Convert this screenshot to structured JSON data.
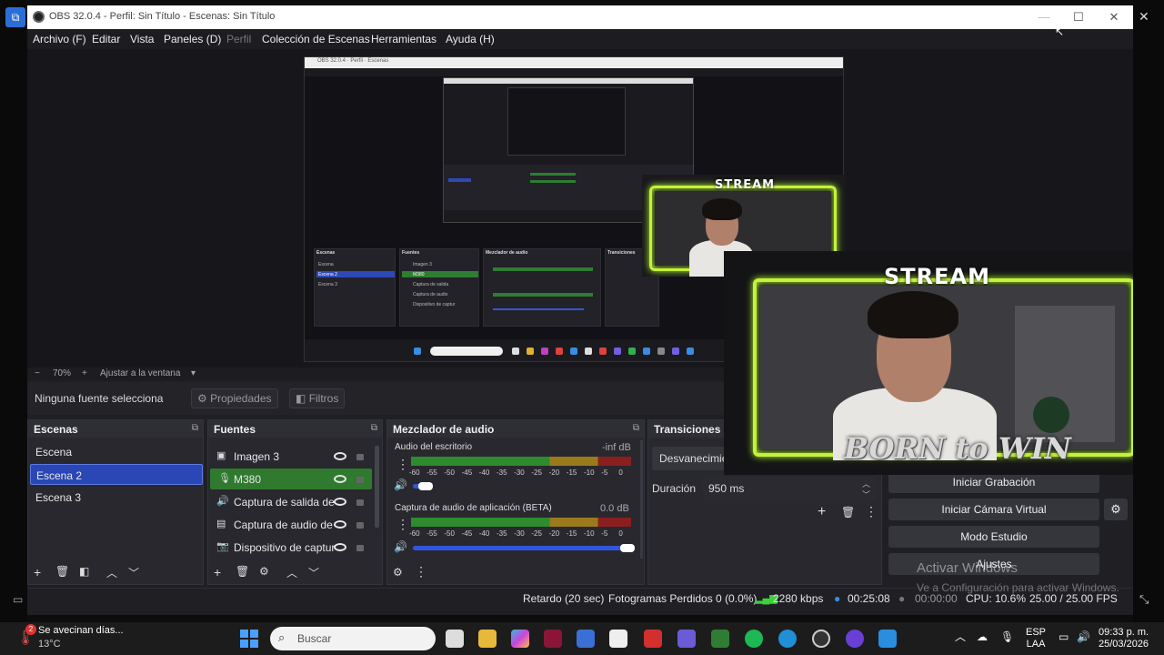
{
  "window": {
    "title": "OBS 32.0.4 - Perfil: Sin Título - Escenas: Sin Título",
    "minimize_icon": "minimize-icon",
    "maximize_icon": "maximize-icon",
    "close_icon": "close-icon"
  },
  "menu": [
    "Archivo (F)",
    "Editar",
    "Vista",
    "Paneles (D)",
    "Perfil",
    "Colección de Escenas",
    "Herramientas",
    "Ayuda (H)"
  ],
  "overlay": {
    "stream_text": "STREAM",
    "born_text": "BORN to WIN"
  },
  "zoom": {
    "minus": "−",
    "value": "70%",
    "plus": "+",
    "fit": "Ajustar a la ventana"
  },
  "source_bar": {
    "no_selection": "Ninguna fuente selecciona",
    "properties": "Propiedades",
    "filters": "Filtros"
  },
  "scenes": {
    "title": "Escenas",
    "items": [
      "Escena",
      "Escena 2",
      "Escena 3"
    ],
    "selected": "Escena 2"
  },
  "sources": {
    "title": "Fuentes",
    "items": [
      {
        "label": "Imagen 3",
        "icon": "image-icon"
      },
      {
        "label": "M380",
        "icon": "microphone-icon"
      },
      {
        "label": "Captura de salida de",
        "icon": "speaker-icon"
      },
      {
        "label": "Captura de audio de",
        "icon": "window-capture-icon"
      },
      {
        "label": "Dispositivo de captur",
        "icon": "camera-icon"
      }
    ]
  },
  "mixer": {
    "title": "Mezclador de audio",
    "tracks": [
      {
        "name": "Audio del escritorio",
        "level": "-inf dB",
        "volume": 0.06
      },
      {
        "name": "Captura de audio de aplicación (BETA)",
        "level": "0.0 dB",
        "volume": 1.0
      }
    ],
    "ticks": [
      "-60",
      "-55",
      "-50",
      "-45",
      "-40",
      "-35",
      "-30",
      "-25",
      "-20",
      "-15",
      "-10",
      "-5",
      "0"
    ]
  },
  "transitions": {
    "title": "Transiciones d",
    "type": "Desvanecimie",
    "duration_label": "Duración",
    "duration_value": "950 ms"
  },
  "controls": {
    "start_recording": "Iniciar Grabación",
    "start_virtual_cam": "Iniciar Cámara Virtual",
    "studio_mode": "Modo Estudio",
    "settings": "Ajustes"
  },
  "watermark": {
    "line1": "Activar Windows",
    "line2": "Ve a Configuración para activar Windows."
  },
  "status": {
    "delay": "Retardo (20 sec)",
    "dropped": "Fotogramas Perdidos 0 (0.0%)",
    "bitrate": "2280 kbps",
    "stream_time": "00:25:08",
    "record_time": "00:00:00",
    "cpu": "CPU: 10.6%",
    "fps": "25.00 / 25.00 FPS"
  },
  "taskbar": {
    "weather_title": "Se avecinan días...",
    "weather_temp": "13°C",
    "weather_badge": "2",
    "search_placeholder": "Buscar",
    "lang_top": "ESP",
    "lang_bottom": "LAA",
    "time": "09:33 p. m.",
    "date": "25/03/2026"
  },
  "colors": {
    "selected": "#2b47b5",
    "active_source": "#2f7a2f",
    "frame_glow": "#c4f23b"
  }
}
